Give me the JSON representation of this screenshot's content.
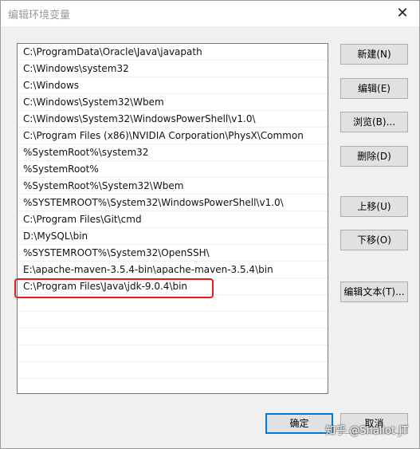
{
  "window": {
    "title": "编辑环境变量",
    "close_glyph": "✕"
  },
  "paths": [
    "C:\\ProgramData\\Oracle\\Java\\javapath",
    "C:\\Windows\\system32",
    "C:\\Windows",
    "C:\\Windows\\System32\\Wbem",
    "C:\\Windows\\System32\\WindowsPowerShell\\v1.0\\",
    "C:\\Program Files (x86)\\NVIDIA Corporation\\PhysX\\Common",
    "%SystemRoot%\\system32",
    "%SystemRoot%",
    "%SystemRoot%\\System32\\Wbem",
    "%SYSTEMROOT%\\System32\\WindowsPowerShell\\v1.0\\",
    "C:\\Program Files\\Git\\cmd",
    "D:\\MySQL\\bin",
    "%SYSTEMROOT%\\System32\\OpenSSH\\",
    "E:\\apache-maven-3.5.4-bin\\apache-maven-3.5.4\\bin",
    "C:\\Program Files\\Java\\jdk-9.0.4\\bin"
  ],
  "buttons": {
    "new": "新建(N)",
    "edit": "编辑(E)",
    "browse": "浏览(B)...",
    "delete": "删除(D)",
    "move_up": "上移(U)",
    "move_down": "下移(O)",
    "edit_text": "编辑文本(T)...",
    "ok": "确定",
    "cancel": "取消"
  },
  "watermark": "知乎 @Shallot JT",
  "colors": {
    "highlight_border": "#e02020",
    "primary_border": "#0078d7",
    "dialog_bg": "#f0f0f0"
  }
}
